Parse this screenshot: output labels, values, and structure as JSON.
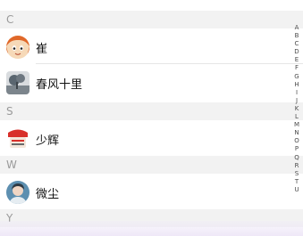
{
  "sections": [
    {
      "letter": "C",
      "contacts": [
        {
          "name": "崔",
          "avatar": "orange-hair-anime-avatar"
        },
        {
          "name": "春风十里",
          "avatar": "tree-landscape-avatar"
        }
      ]
    },
    {
      "letter": "S",
      "contacts": [
        {
          "name": "少辉",
          "avatar": "red-badge-avatar"
        }
      ]
    },
    {
      "letter": "W",
      "contacts": [
        {
          "name": "微尘",
          "avatar": "blue-portrait-avatar"
        }
      ]
    },
    {
      "letter": "Y",
      "contacts": []
    }
  ],
  "index_letters": [
    "A",
    "B",
    "C",
    "D",
    "E",
    "F",
    "G",
    "H",
    "I",
    "J",
    "K",
    "L",
    "M",
    "N",
    "O",
    "P",
    "Q",
    "R",
    "S",
    "T",
    "U"
  ]
}
